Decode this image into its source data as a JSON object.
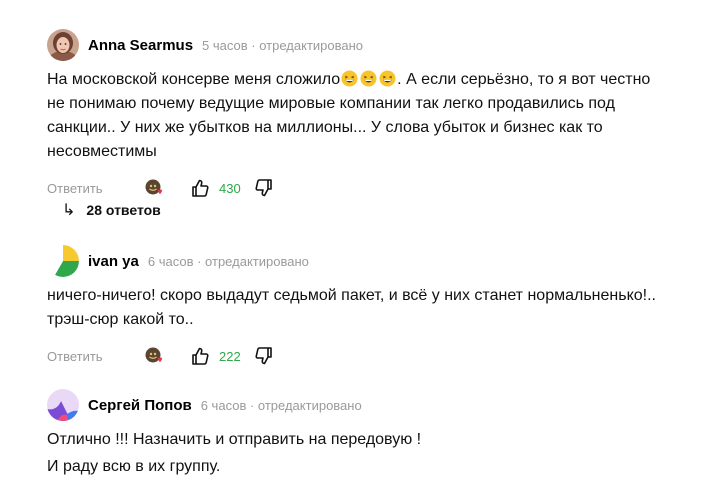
{
  "comments": [
    {
      "author": "Anna Searmus",
      "meta": "5 часов · отредактировано",
      "text_lines": [
        "На московской консерве меня сложило",
        ". А если серьёзно, то я вот честно не понимаю почему ведущие мировые компании так легко продавились под санкции.. У них же убытков на миллионы... У слова убыток и бизнес как то несовместимы"
      ],
      "reply_label": "Ответить",
      "like_count": "430"
    },
    {
      "author": "ivan ya",
      "meta": "6 часов · отредактировано",
      "text": "ничего-ничего! скоро выдадут седьмой пакет, и всё у них станет нормальненько!.. трэш-сюр какой то..",
      "reply_label": "Ответить",
      "like_count": "222"
    },
    {
      "author": "Сергей Попов",
      "meta": "6 часов · отредактировано",
      "paragraphs": [
        "Отлично !!! Назначить и отправить на передовую !",
        "И раду всю в их группу."
      ]
    }
  ],
  "replies_link": {
    "arrow": "↳",
    "label": "28 ответов"
  },
  "colors": {
    "like_count": "#2ea84b",
    "meta": "#9a9a9a"
  },
  "icons": [
    "thumbs-up-icon",
    "thumbs-down-icon",
    "reaction-emoji-icon",
    "reply-arrow-icon",
    "laughing-emoji-icon"
  ]
}
